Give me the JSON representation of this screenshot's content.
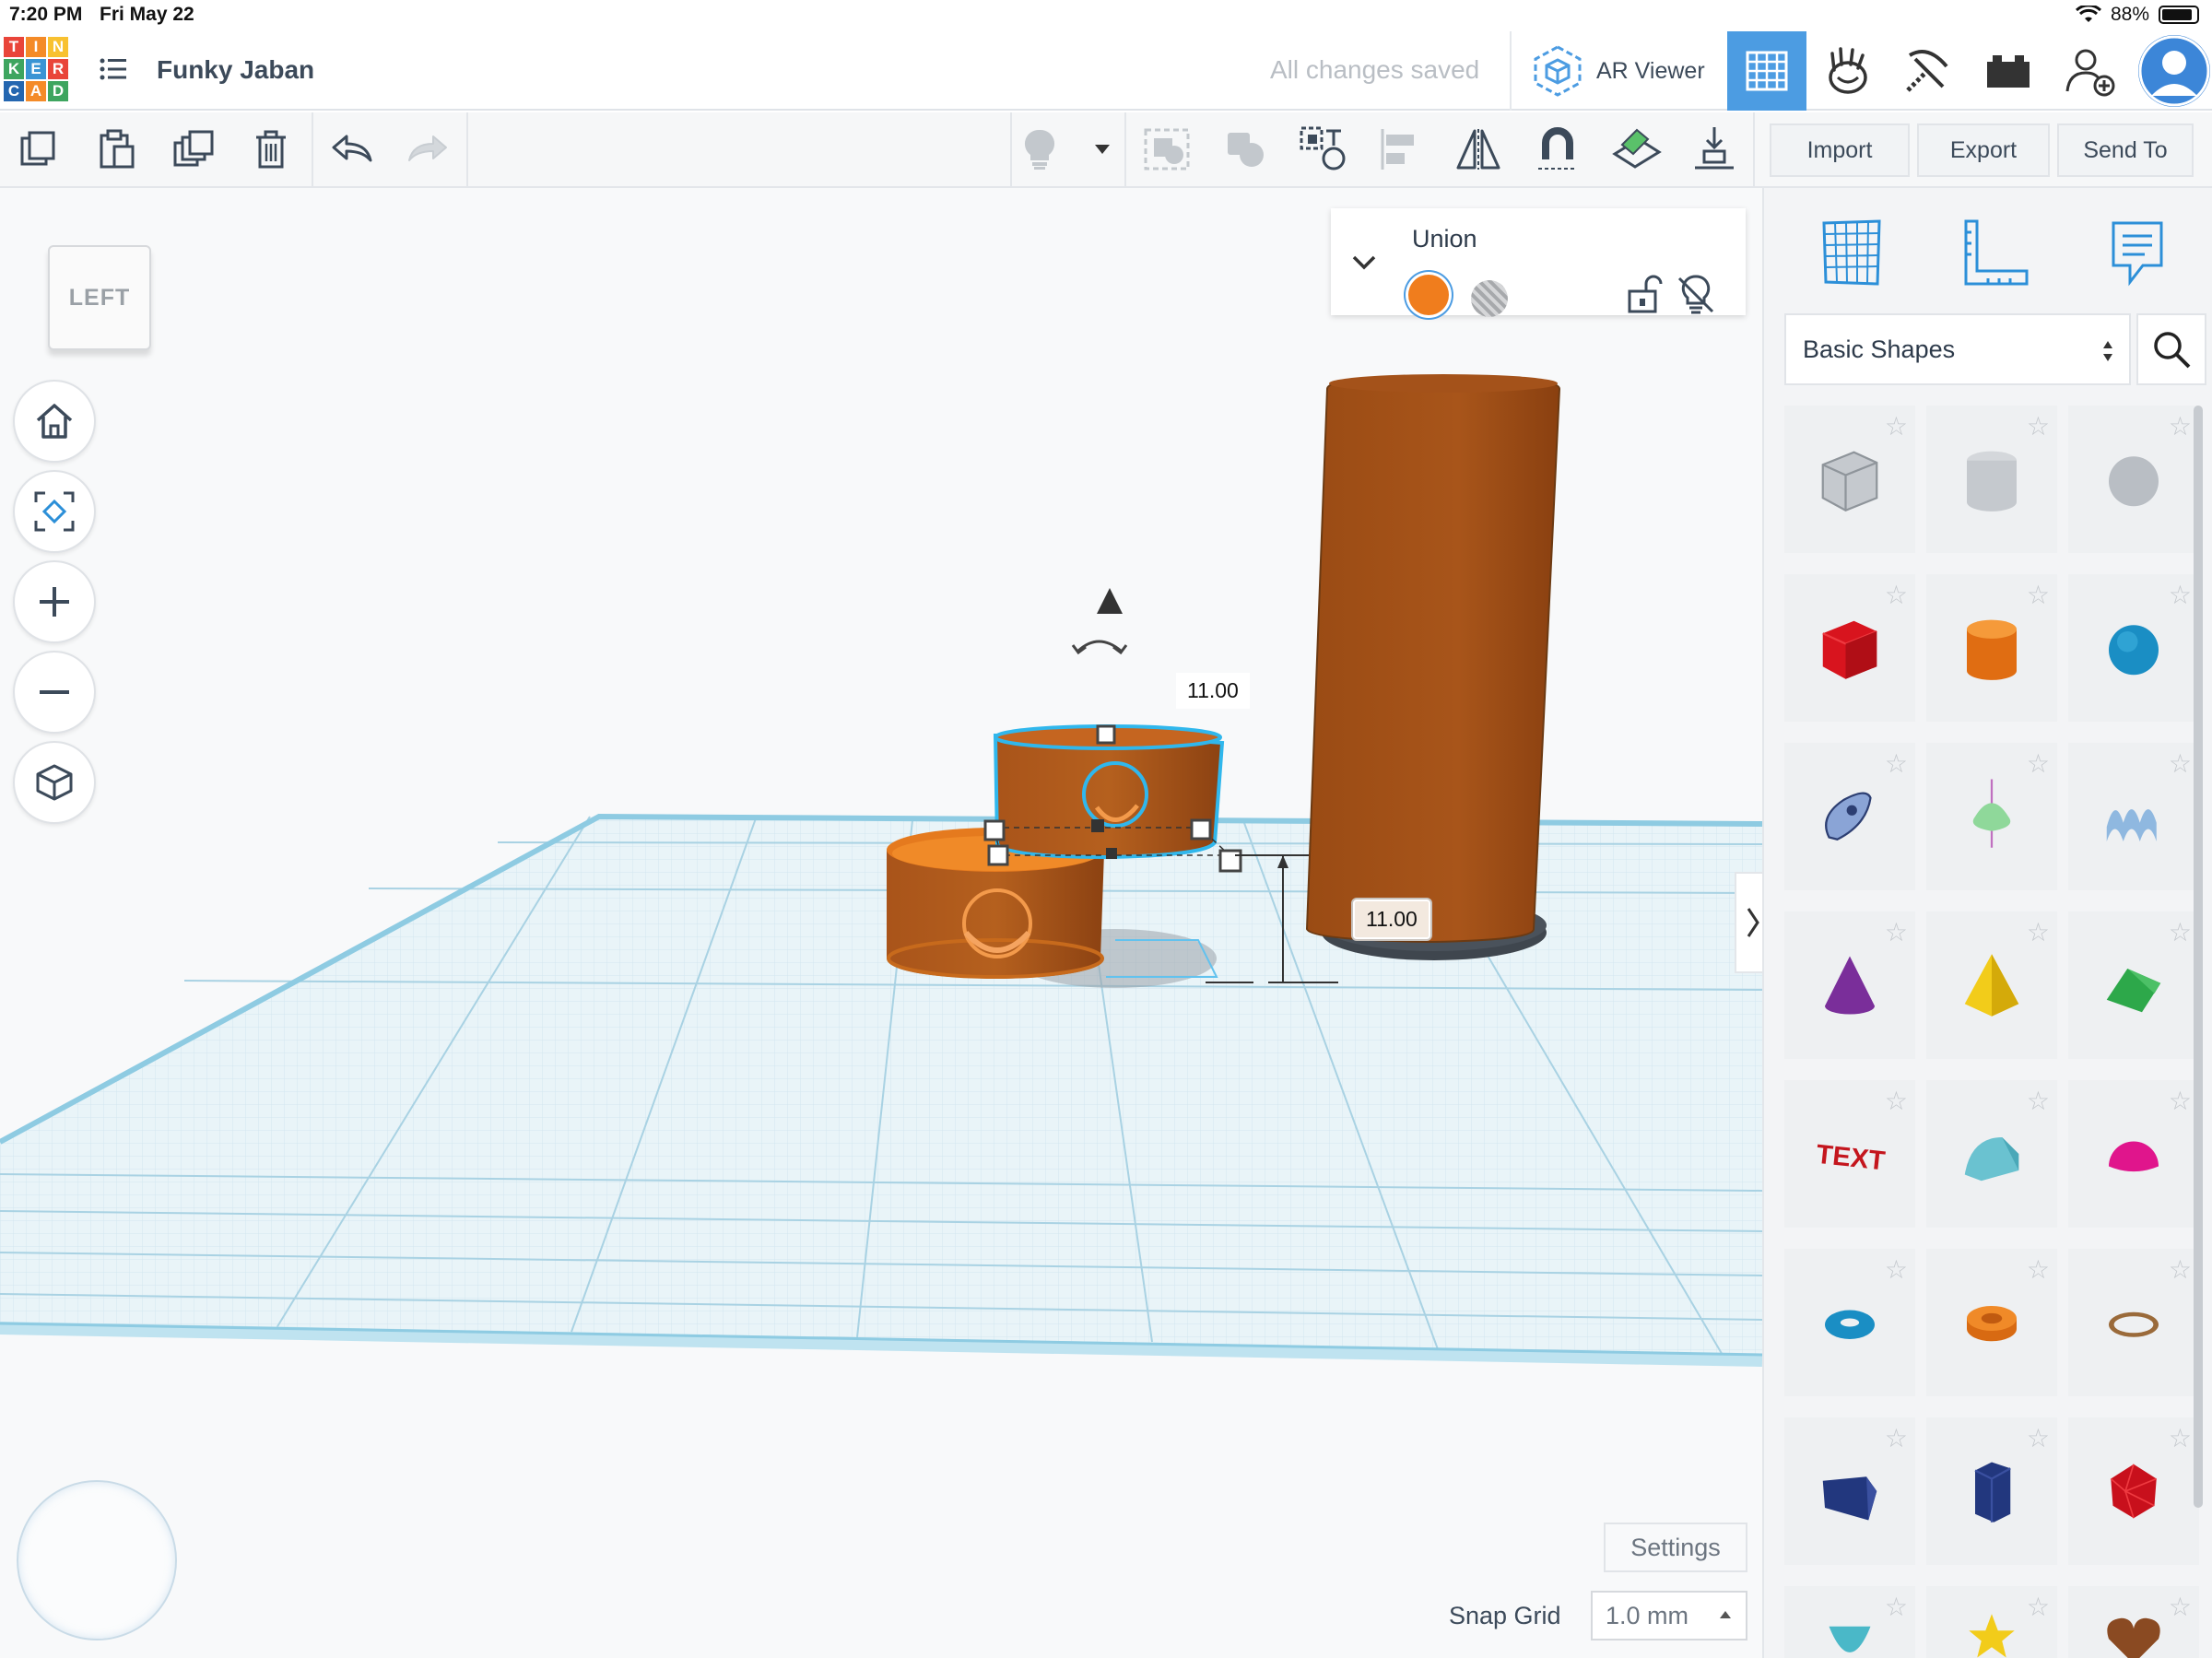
{
  "status_bar": {
    "time": "7:20 PM",
    "date": "Fri May 22",
    "battery": "88%",
    "battery_level": 0.88
  },
  "header": {
    "logo_letters": [
      "T",
      "I",
      "N",
      "K",
      "E",
      "R",
      "C",
      "A",
      "D"
    ],
    "logo_colors": [
      "#e9453a",
      "#f48b28",
      "#f8c131",
      "#3ea55f",
      "#3a94d4",
      "#e9453a",
      "#2466b0",
      "#f48b28",
      "#3ea55f"
    ],
    "project_name": "Funky Jaban",
    "save_status": "All changes saved",
    "ar_viewer_label": "AR Viewer"
  },
  "toolbar": {
    "import_label": "Import",
    "export_label": "Export",
    "send_to_label": "Send To"
  },
  "viewcube": {
    "face_label": "LEFT"
  },
  "inspector": {
    "title": "Union",
    "solid_color": "#f07d1d",
    "hole_label": "hole"
  },
  "dimensions": {
    "width_label": "11.00",
    "elevation_label": "11.00"
  },
  "workplane": {
    "settings_label": "Settings",
    "snap_grid_label": "Snap Grid",
    "snap_grid_value": "1.0 mm"
  },
  "shapes_panel": {
    "category": "Basic Shapes",
    "shapes": [
      {
        "name": "Box Hole",
        "icon": "box-hole-icon"
      },
      {
        "name": "Cylinder Hole",
        "icon": "cylinder-hole-icon"
      },
      {
        "name": "Sphere Hole",
        "icon": "sphere-hole-icon"
      },
      {
        "name": "Box",
        "icon": "box-icon"
      },
      {
        "name": "Cylinder",
        "icon": "cylinder-icon"
      },
      {
        "name": "Sphere",
        "icon": "sphere-icon"
      },
      {
        "name": "Scribble",
        "icon": "scribble-icon"
      },
      {
        "name": "Shape Generator",
        "icon": "revolver-icon"
      },
      {
        "name": "Wave",
        "icon": "wave-icon"
      },
      {
        "name": "Cone",
        "icon": "cone-icon"
      },
      {
        "name": "Pyramid",
        "icon": "pyramid-icon"
      },
      {
        "name": "Roof",
        "icon": "roof-icon"
      },
      {
        "name": "Text",
        "icon": "text-icon"
      },
      {
        "name": "Round Roof",
        "icon": "round-roof-icon"
      },
      {
        "name": "Half Sphere",
        "icon": "half-sphere-icon"
      },
      {
        "name": "Torus",
        "icon": "torus-icon"
      },
      {
        "name": "Tube",
        "icon": "tube-icon"
      },
      {
        "name": "Ring",
        "icon": "ring-icon"
      },
      {
        "name": "Wedge",
        "icon": "wedge-icon"
      },
      {
        "name": "Polygon",
        "icon": "polygon-icon"
      },
      {
        "name": "Icosahedron",
        "icon": "icosahedron-icon"
      },
      {
        "name": "Paraboloid",
        "icon": "paraboloid-icon"
      },
      {
        "name": "Star",
        "icon": "star-icon"
      },
      {
        "name": "Heart",
        "icon": "heart-icon"
      }
    ]
  }
}
